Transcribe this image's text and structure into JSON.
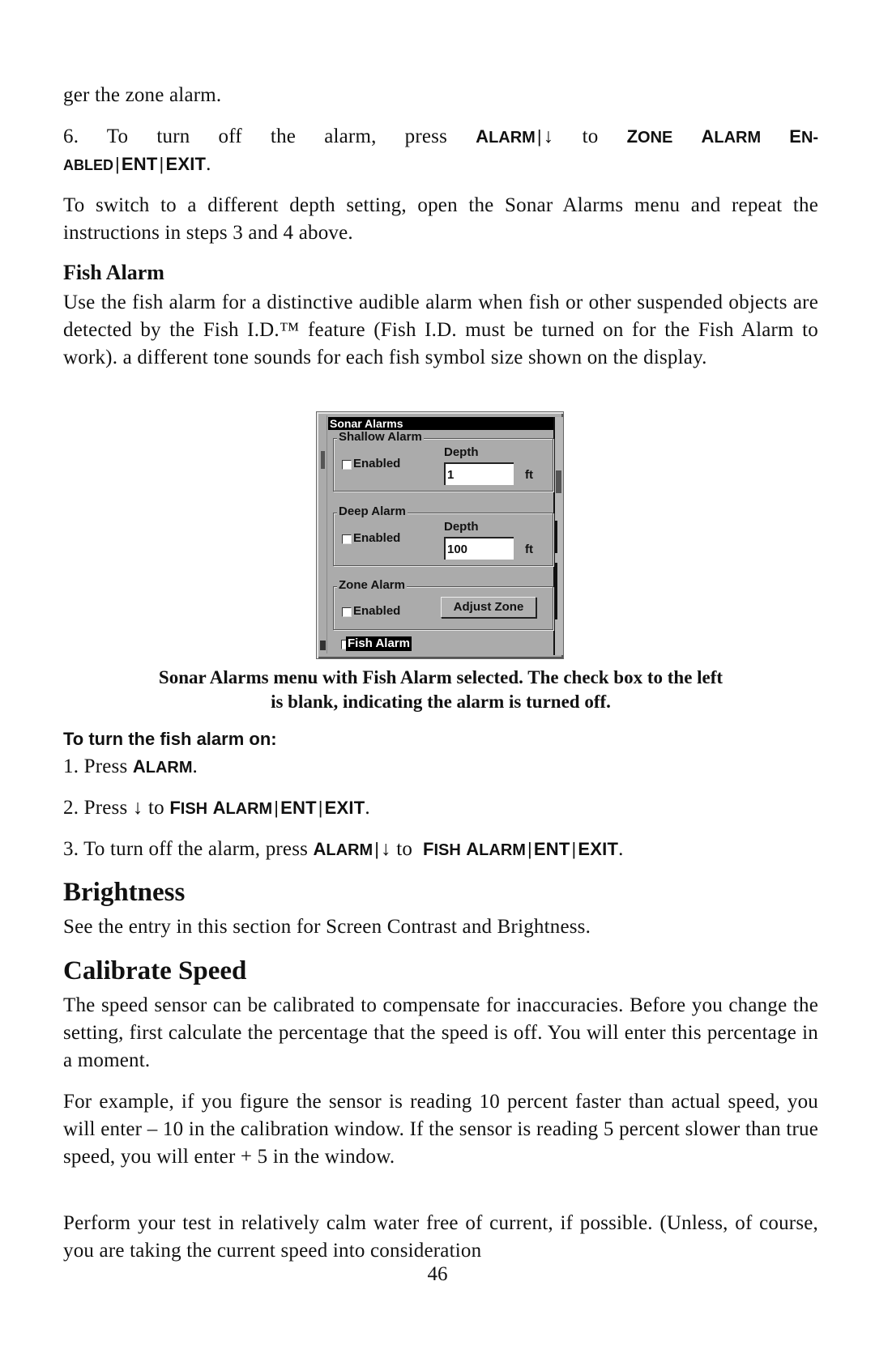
{
  "top_fragment": "ger the zone alarm.",
  "step6": {
    "prefix": "6. To turn off the alarm, press",
    "k_alarm_cap": "A",
    "k_alarm_rest": "LARM",
    "bar": "|",
    "arrow": "↓",
    "to": "to",
    "k_zone_cap": "Z",
    "k_zone_rest": "ONE",
    "k_alarm2_cap": "A",
    "k_alarm2_rest": "LARM",
    "k_en_cap": "E",
    "k_en_rest": "N-",
    "k_abled": "ABLED",
    "k_ent": "ENT",
    "k_exit": "EXIT",
    "period": "."
  },
  "switch_para": "To switch to a different depth setting, open the Sonar Alarms menu and repeat the instructions in steps 3  and 4 above.",
  "fish_alarm": {
    "heading": "Fish Alarm",
    "para": "Use the fish alarm for a distinctive audible alarm when fish or other suspended objects are detected by the Fish I.D.™ feature (Fish I.D. must be turned on for the Fish Alarm to work). a different tone sounds for each fish symbol size shown on the display."
  },
  "dialog": {
    "title": "Sonar Alarms",
    "shallow": {
      "label": "Shallow Alarm",
      "enabled_label": "Enabled",
      "enabled": false,
      "depth_label": "Depth",
      "depth_value": "1",
      "unit": "ft"
    },
    "deep": {
      "label": "Deep Alarm",
      "enabled_label": "Enabled",
      "enabled": false,
      "depth_label": "Depth",
      "depth_value": "100",
      "unit": "ft"
    },
    "zone": {
      "label": "Zone Alarm",
      "enabled_label": "Enabled",
      "enabled": false,
      "button": "Adjust Zone"
    },
    "fish": {
      "label": "Fish Alarm",
      "enabled": false,
      "selected": true
    }
  },
  "caption": {
    "line1": "Sonar Alarms menu with Fish Alarm selected. The check box to the left",
    "line2": "is blank, indicating the alarm is turned off."
  },
  "turn_on": {
    "heading": "To turn the fish alarm on:",
    "step1_prefix": "1. Press",
    "step2_prefix": "2. Press",
    "step2_to": "to",
    "step3_prefix": "3. To turn off the alarm, press",
    "step3_to": "to",
    "k_alarm_cap": "A",
    "k_alarm_rest": "LARM",
    "k_fish_cap": "F",
    "k_fish_rest": "ISH",
    "k_ent": "ENT",
    "k_exit": "EXIT",
    "arrow": "↓",
    "bar": "|",
    "period": "."
  },
  "brightness": {
    "heading": "Brightness",
    "para": "See the entry in this section for Screen Contrast and Brightness."
  },
  "calibrate": {
    "heading": "Calibrate Speed",
    "para1": "The speed sensor can be calibrated to compensate for inaccuracies. Before you change the setting, first calculate the percentage that the speed is off. You will enter this percentage in a moment.",
    "para2": "For example, if you figure the sensor is reading 10 percent faster than actual speed, you will enter – 10 in the calibration window. If the sensor is reading 5 percent slower than true speed, you will enter + 5 in the window.",
    "para3": "Perform your test in relatively calm water free of current, if possible. (Unless, of course, you are taking the current speed into consideration"
  },
  "page_number": "46"
}
